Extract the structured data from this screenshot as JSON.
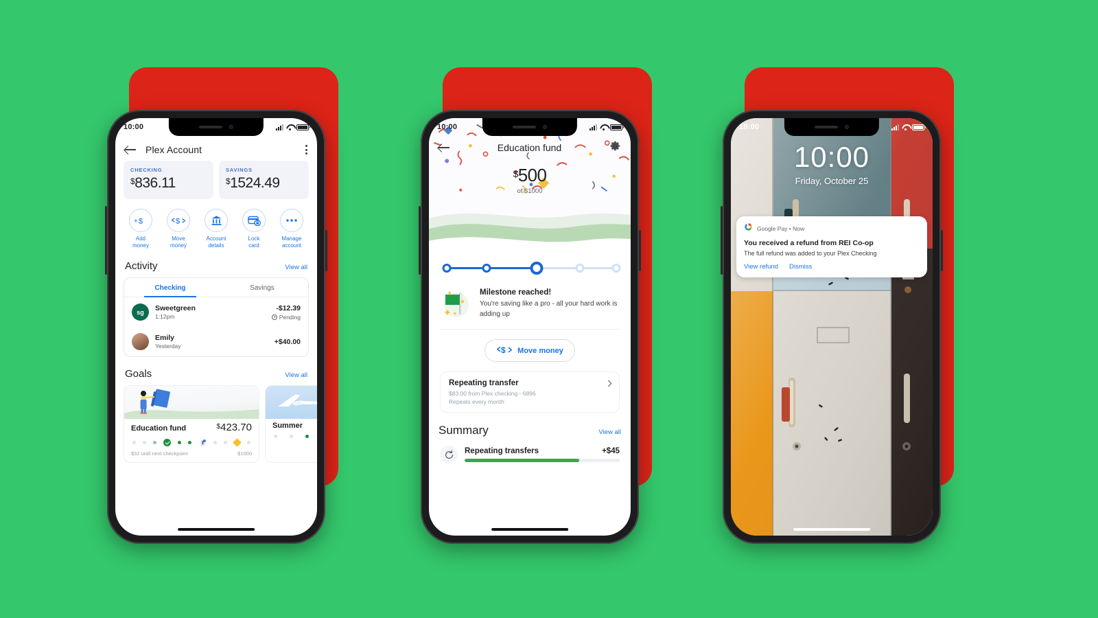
{
  "background": {
    "green": "#34c76b",
    "red": "#dd2418"
  },
  "phone1": {
    "status": {
      "time": "10:00"
    },
    "appbar": {
      "title": "Plex Account",
      "back_icon": "arrow-left-icon",
      "menu_icon": "kebab-menu-icon"
    },
    "balances": [
      {
        "label": "CHECKING",
        "currency": "$",
        "amount": "836.11"
      },
      {
        "label": "SAVINGS",
        "currency": "$",
        "amount": "1524.49"
      }
    ],
    "actions": [
      {
        "icon": "add-money-icon",
        "label": "Add\nmoney",
        "line1": "Add",
        "line2": "money"
      },
      {
        "icon": "move-money-icon",
        "label": "Move money",
        "line1": "Move",
        "line2": "money"
      },
      {
        "icon": "bank-icon",
        "label": "Account details",
        "line1": "Account",
        "line2": "details"
      },
      {
        "icon": "lock-card-icon",
        "label": "Lock card",
        "line1": "Lock",
        "line2": "card"
      },
      {
        "icon": "more-icon",
        "label": "Manage account",
        "line1": "Manage",
        "line2": "account"
      }
    ],
    "activity": {
      "heading": "Activity",
      "view_all": "View all",
      "tabs": [
        {
          "label": "Checking",
          "active": true
        },
        {
          "label": "Savings",
          "active": false
        }
      ],
      "transactions": [
        {
          "avatar_text": "sg",
          "avatar_color": "#0b6b4f",
          "name": "Sweetgreen",
          "time": "1:12pm",
          "amount": "-$12.39",
          "status": "Pending",
          "status_icon": "clock-icon"
        },
        {
          "avatar_text": "",
          "avatar_color": "#b08266",
          "name": "Emily",
          "time": "Yesterday",
          "amount": "+$40.00",
          "status": "",
          "status_icon": ""
        }
      ]
    },
    "goals": {
      "heading": "Goals",
      "view_all": "View all",
      "items": [
        {
          "name": "Education fund",
          "currency": "$",
          "amount": "423.70",
          "footer_left": "$32 until next checkpoint",
          "footer_right": "$1000"
        },
        {
          "name": "Summer",
          "currency": "",
          "amount": "",
          "footer_left": "",
          "footer_right": ""
        }
      ]
    }
  },
  "phone2": {
    "status": {
      "time": "10:00"
    },
    "appbar": {
      "title": "Education fund",
      "back_icon": "arrow-left-icon",
      "settings_icon": "gear-icon"
    },
    "goal": {
      "currency": "$",
      "saved": "500",
      "of_label": "of $1000"
    },
    "progress": {
      "nodes": 5,
      "current_index": 2,
      "filled": 3
    },
    "milestone": {
      "icon": "green-flag-icon",
      "title": "Milestone reached!",
      "body": "You're saving like a pro - all your hard work is adding up"
    },
    "move_button": {
      "icon": "move-money-icon",
      "label": "Move money"
    },
    "repeating_transfer": {
      "title": "Repeating transfer",
      "line1": "$83.00 from Plex checking - 6896",
      "line2": "Repeats every month",
      "chevron": "chevron-right-icon"
    },
    "summary": {
      "heading": "Summary",
      "view_all": "View all",
      "rows": [
        {
          "icon": "repeat-icon",
          "name": "Repeating transfers",
          "amount": "+$45",
          "progress_pct": 74
        }
      ]
    }
  },
  "phone3": {
    "status": {
      "time": "10:00"
    },
    "lockscreen": {
      "clock": "10:00",
      "date": "Friday, October 25"
    },
    "notification": {
      "app_icon": "google-pay-icon",
      "app_name": "Google Pay",
      "separator": "•",
      "timestamp": "Now",
      "title": "You received a refund from REI Co-op",
      "body": "The full refund was added to your Plex Checking",
      "actions": [
        {
          "label": "View refund"
        },
        {
          "label": "Dismiss"
        }
      ]
    }
  }
}
